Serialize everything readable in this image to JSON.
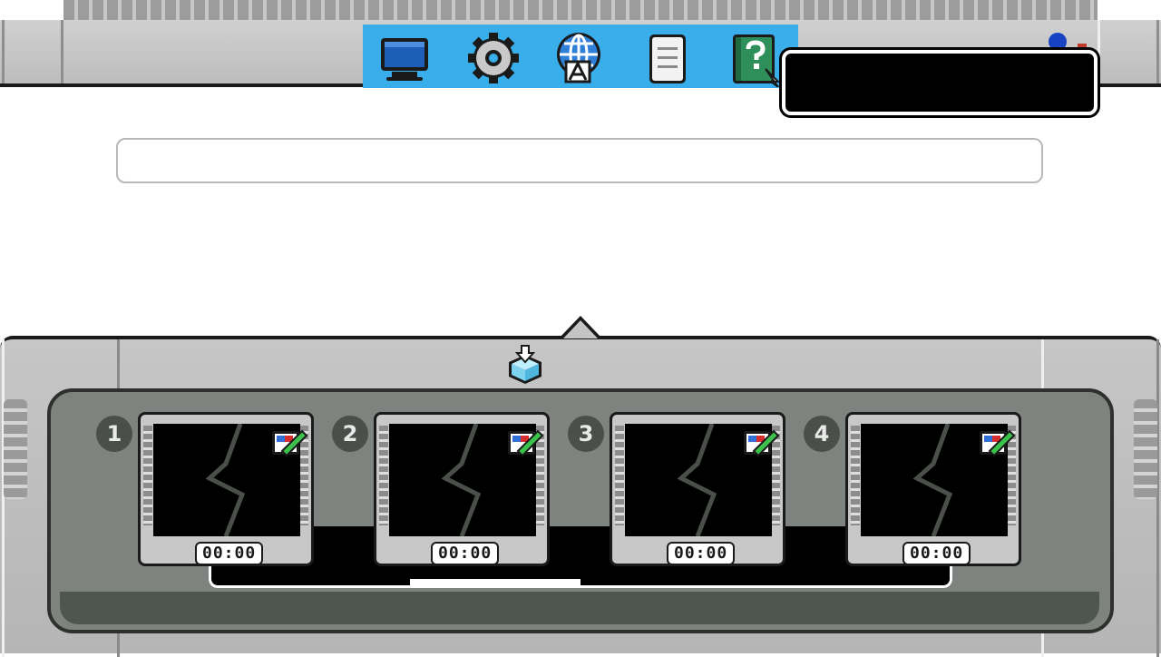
{
  "toolbar": {
    "items": [
      {
        "name": "display-icon",
        "label": ""
      },
      {
        "name": "settings-gear-icon",
        "label": ""
      },
      {
        "name": "globe-language-icon",
        "label": ""
      },
      {
        "name": "document-icon",
        "label": ""
      },
      {
        "name": "help-book-icon",
        "label": ""
      }
    ],
    "accent": "#3aaeea"
  },
  "tooltip": {
    "text": ""
  },
  "search": {
    "value": "",
    "placeholder": ""
  },
  "dock": {
    "eject_icon": "eject-icon",
    "slots": [
      {
        "number": "1",
        "time": "00:00"
      },
      {
        "number": "2",
        "time": "00:00"
      },
      {
        "number": "3",
        "time": "00:00"
      },
      {
        "number": "4",
        "time": "00:00"
      }
    ]
  },
  "colors": {
    "frame": "#c6c6c6",
    "tray": "#7f837f",
    "shelf": "#000000"
  }
}
